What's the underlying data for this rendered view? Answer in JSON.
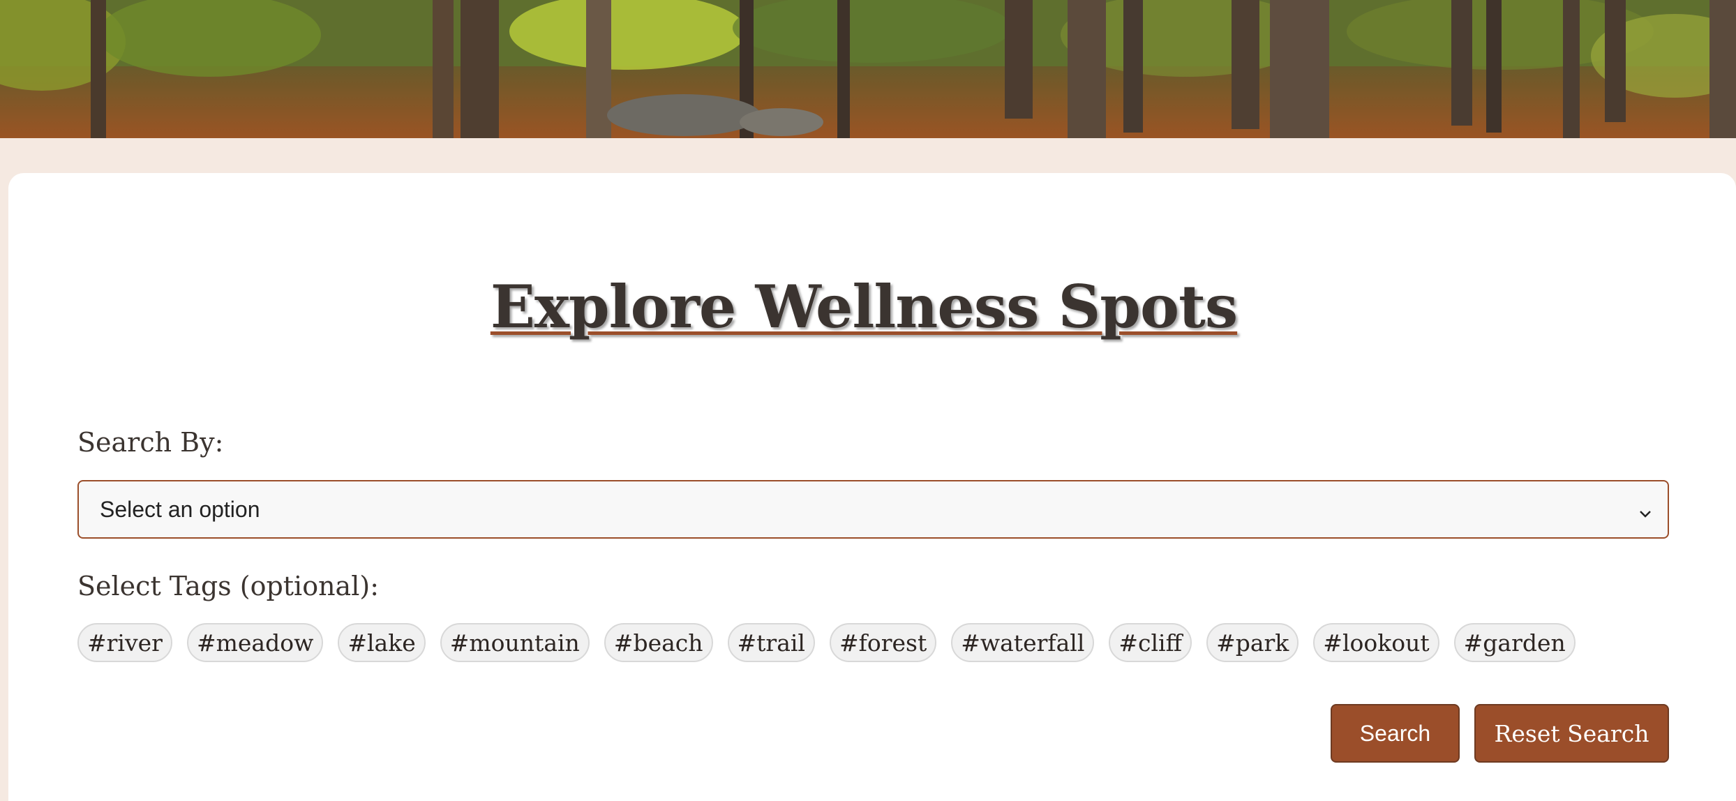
{
  "page": {
    "title": "Explore Wellness Spots"
  },
  "search": {
    "label": "Search By:",
    "selected": "Select an option"
  },
  "tags": {
    "label": "Select Tags (optional):",
    "items": [
      "#river",
      "#meadow",
      "#lake",
      "#mountain",
      "#beach",
      "#trail",
      "#forest",
      "#waterfall",
      "#cliff",
      "#park",
      "#lookout",
      "#garden"
    ]
  },
  "buttons": {
    "search": "Search",
    "reset": "Reset Search"
  },
  "colors": {
    "accent": "#9b4e2a",
    "page_background": "#f5e9e1",
    "card_background": "#ffffff",
    "tag_background": "#f1f1f1"
  },
  "icons": {
    "select_arrow": "chevron-down-icon"
  }
}
